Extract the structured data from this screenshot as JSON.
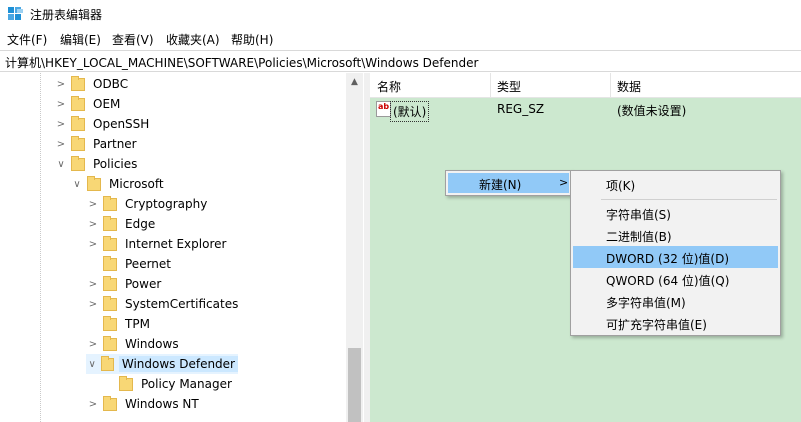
{
  "window": {
    "title": "注册表编辑器"
  },
  "menu": [
    "文件(F)",
    "编辑(E)",
    "查看(V)",
    "收藏夹(A)",
    "帮助(H)"
  ],
  "address": "计算机\\HKEY_LOCAL_MACHINE\\SOFTWARE\\Policies\\Microsoft\\Windows Defender",
  "tree": {
    "items": [
      {
        "label": "ODBC",
        "chevron": ">"
      },
      {
        "label": "OEM",
        "chevron": ">"
      },
      {
        "label": "OpenSSH",
        "chevron": ">"
      },
      {
        "label": "Partner",
        "chevron": ">"
      },
      {
        "label": "Policies",
        "chevron": "∨"
      },
      {
        "label": "Microsoft",
        "chevron": "∨"
      },
      {
        "label": "Cryptography",
        "chevron": ">"
      },
      {
        "label": "Edge",
        "chevron": ">"
      },
      {
        "label": "Internet Explorer",
        "chevron": ">"
      },
      {
        "label": "Peernet",
        "chevron": ""
      },
      {
        "label": "Power",
        "chevron": ">"
      },
      {
        "label": "SystemCertificates",
        "chevron": ">"
      },
      {
        "label": "TPM",
        "chevron": ""
      },
      {
        "label": "Windows",
        "chevron": ">"
      },
      {
        "label": "Windows Defender",
        "chevron": "∨"
      },
      {
        "label": "Policy Manager",
        "chevron": ""
      },
      {
        "label": "Windows NT",
        "chevron": ">"
      }
    ],
    "selected": "Windows Defender"
  },
  "columns": {
    "name": "名称",
    "type": "类型",
    "data": "数据"
  },
  "values": [
    {
      "icon_text": "ab",
      "name": "(默认)",
      "type": "REG_SZ",
      "data": "(数值未设置)"
    }
  ],
  "context_menu": {
    "new_label": "新建(N)",
    "new_arrow": ">",
    "submenu": [
      "项(K)",
      "字符串值(S)",
      "二进制值(B)",
      "DWORD (32 位)值(D)",
      "QWORD (64 位)值(Q)",
      "多字符串值(M)",
      "可扩充字符串值(E)"
    ],
    "highlighted": "DWORD (32 位)值(D)"
  },
  "colors": {
    "list_background": "#cce8cf",
    "menu_highlight": "#91c9f7",
    "selection": "#cce8ff"
  }
}
